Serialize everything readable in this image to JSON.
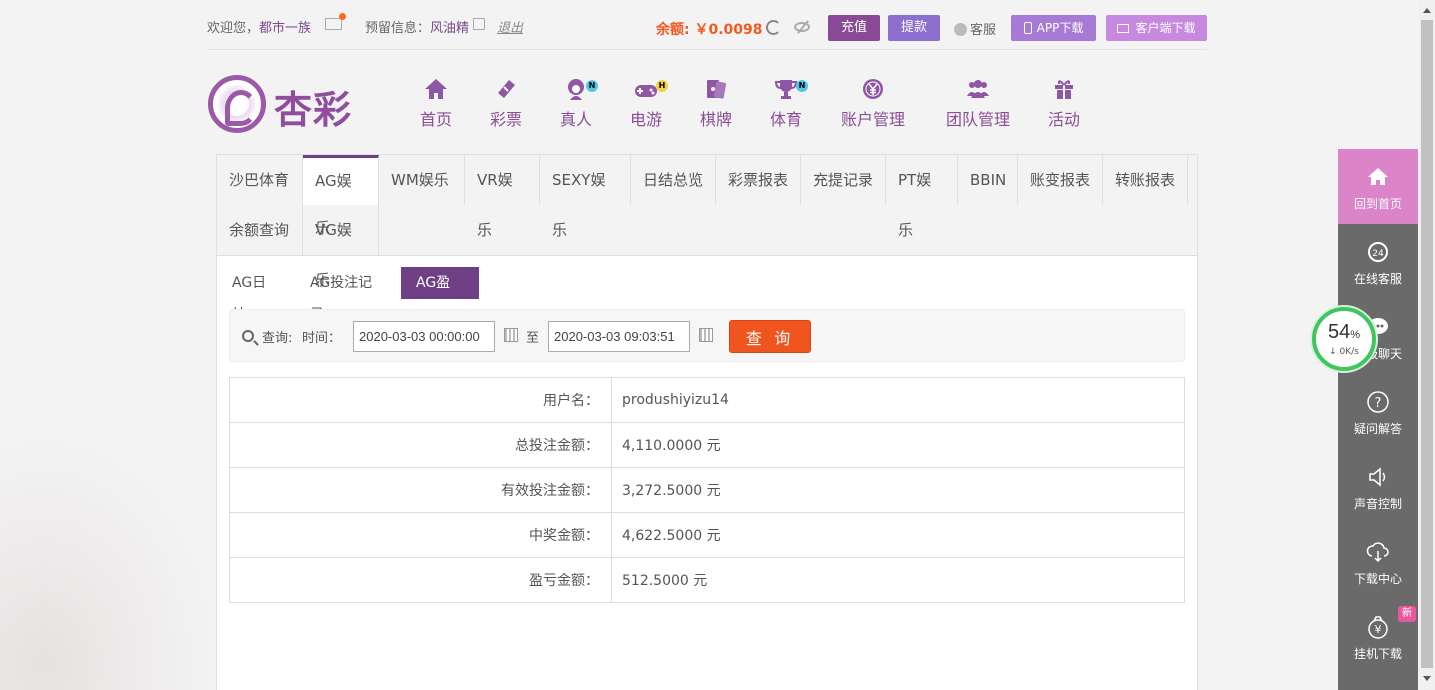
{
  "topbar": {
    "welcome_prefix": "欢迎您，",
    "username": "都市一族",
    "reserved_prefix": "预留信息：",
    "reserved_name": "风油精",
    "logout": "退出",
    "balance": "余额: ￥0.0098",
    "recharge": "充值",
    "withdraw": "提款",
    "kefu": "客服",
    "app_download": "APP下载",
    "client_download": "客户端下载"
  },
  "logo": {
    "text": "杏彩"
  },
  "nav": [
    {
      "label": "首页",
      "icon": "home-icon"
    },
    {
      "label": "彩票",
      "icon": "lottery-icon"
    },
    {
      "label": "真人",
      "icon": "live-dealer-icon",
      "badge": "N"
    },
    {
      "label": "电游",
      "icon": "gamepad-icon",
      "badge": "H"
    },
    {
      "label": "棋牌",
      "icon": "cards-icon"
    },
    {
      "label": "体育",
      "icon": "trophy-icon",
      "badge": "N"
    },
    {
      "label": "账户管理",
      "icon": "yen-coin-icon"
    },
    {
      "label": "团队管理",
      "icon": "team-icon"
    },
    {
      "label": "活动",
      "icon": "gift-icon"
    }
  ],
  "tabs": [
    "沙巴体育",
    "AG娱乐",
    "WM娱乐",
    "VR娱乐",
    "SEXY娱乐",
    "日结总览",
    "彩票报表",
    "充提记录",
    "PT娱乐",
    "BBIN",
    "账变报表",
    "转账报表",
    "余额查询",
    "VG娱乐"
  ],
  "active_tab": "AG娱乐",
  "subtabs": [
    "AG日结",
    "AG投注记录",
    "AG盈亏"
  ],
  "active_subtab": "AG盈亏",
  "search": {
    "query_label": "查询:",
    "time_label": "时间：",
    "start": "2020-03-03 00:00:00",
    "to_label": "至",
    "end": "2020-03-03 09:03:51",
    "button": "查 询"
  },
  "result": [
    {
      "key": "用户名：",
      "value": "produshiyizu14"
    },
    {
      "key": "总投注金额：",
      "value": "4,110.0000 元"
    },
    {
      "key": "有效投注金额：",
      "value": "3,272.5000 元"
    },
    {
      "key": "中奖金额：",
      "value": "4,622.5000 元"
    },
    {
      "key": "盈亏金额：",
      "value": "512.5000 元"
    }
  ],
  "sidebar": [
    {
      "label": "回到首页",
      "icon": "home-icon"
    },
    {
      "label": "在线客服",
      "icon": "headset-24-icon"
    },
    {
      "label": "超级聊天",
      "icon": "chat-icon"
    },
    {
      "label": "疑问解答",
      "icon": "question-icon"
    },
    {
      "label": "声音控制",
      "icon": "speaker-icon"
    },
    {
      "label": "下载中心",
      "icon": "cloud-download-icon"
    },
    {
      "label": "挂机下载",
      "icon": "money-bag-icon"
    }
  ],
  "sidebar_new_badge": "新",
  "speed_widget": {
    "percent": "54",
    "percent_unit": "%",
    "rate": "0K/s"
  },
  "colors": {
    "brand": "#6e3f85",
    "accent": "#f0551f",
    "sidebar": "#6a6a6a",
    "sidebar_home": "#dc84c9"
  }
}
